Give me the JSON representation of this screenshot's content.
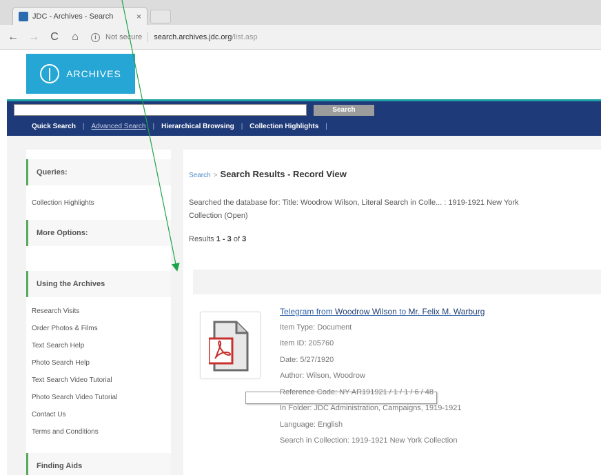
{
  "browser": {
    "tab_title": "JDC - Archives - Search",
    "tab_close": "×",
    "nav_back": "←",
    "nav_forward": "→",
    "nav_reload": "C",
    "nav_home": "⌂",
    "info_glyph": "i",
    "security_label": "Not secure",
    "url_host": "search.archives.jdc.org",
    "url_path": "/list.asp"
  },
  "site": {
    "logo_text": "ARCHIVES",
    "brand_color": "#26a6d4",
    "accent_color": "#1aa0a6",
    "nav_color": "#1f3a78"
  },
  "search": {
    "value": "",
    "button_label": "Search"
  },
  "nav": {
    "links": [
      "Quick Search",
      "Advanced Search",
      "Hierarchical Browsing",
      "Collection Highlights"
    ],
    "pipe": "|"
  },
  "sidebar": {
    "queries_heading": "Queries:",
    "queries_items": [
      "Collection Highlights"
    ],
    "more_options_heading": "More Options:",
    "using_heading": "Using the Archives",
    "using_items": [
      "Research Visits",
      "Order Photos & Films",
      "Text Search Help",
      "Photo Search Help",
      "Text Search Video Tutorial",
      "Photo Search Video Tutorial",
      "Contact Us",
      "Terms and Conditions"
    ],
    "finding_heading": "Finding Aids"
  },
  "main": {
    "breadcrumb_link": "Search",
    "breadcrumb_sep": ">",
    "breadcrumb_current": "Search Results - Record View",
    "searched_text": "Searched the database for: Title: Woodrow Wilson, Literal Search in Colle... : 1919-1921 New York\nCollection (Open)",
    "results_prefix": "Results",
    "results_range": "1 - 3",
    "results_of": "of",
    "results_total": "3"
  },
  "record": {
    "title_link1": "Telegram from",
    "title_bold1": "Woodrow Wilson",
    "title_link2": "to",
    "title_bold2": "Mr. Felix M. Warburg",
    "item_type": "Item Type: Document",
    "item_id": "Item ID: 205760",
    "date": "Date: 5/27/1920",
    "author": "Author: Wilson, Woodrow",
    "reference_code": "Reference Code: NY AR191921 / 1 / 1 / 6 / 48",
    "in_folder": "In Folder: JDC Administration, Campaigns, 1919-1921",
    "language": "Language: English",
    "search_in_collection": "Search in Collection: 1919-1921 New York Collection"
  }
}
